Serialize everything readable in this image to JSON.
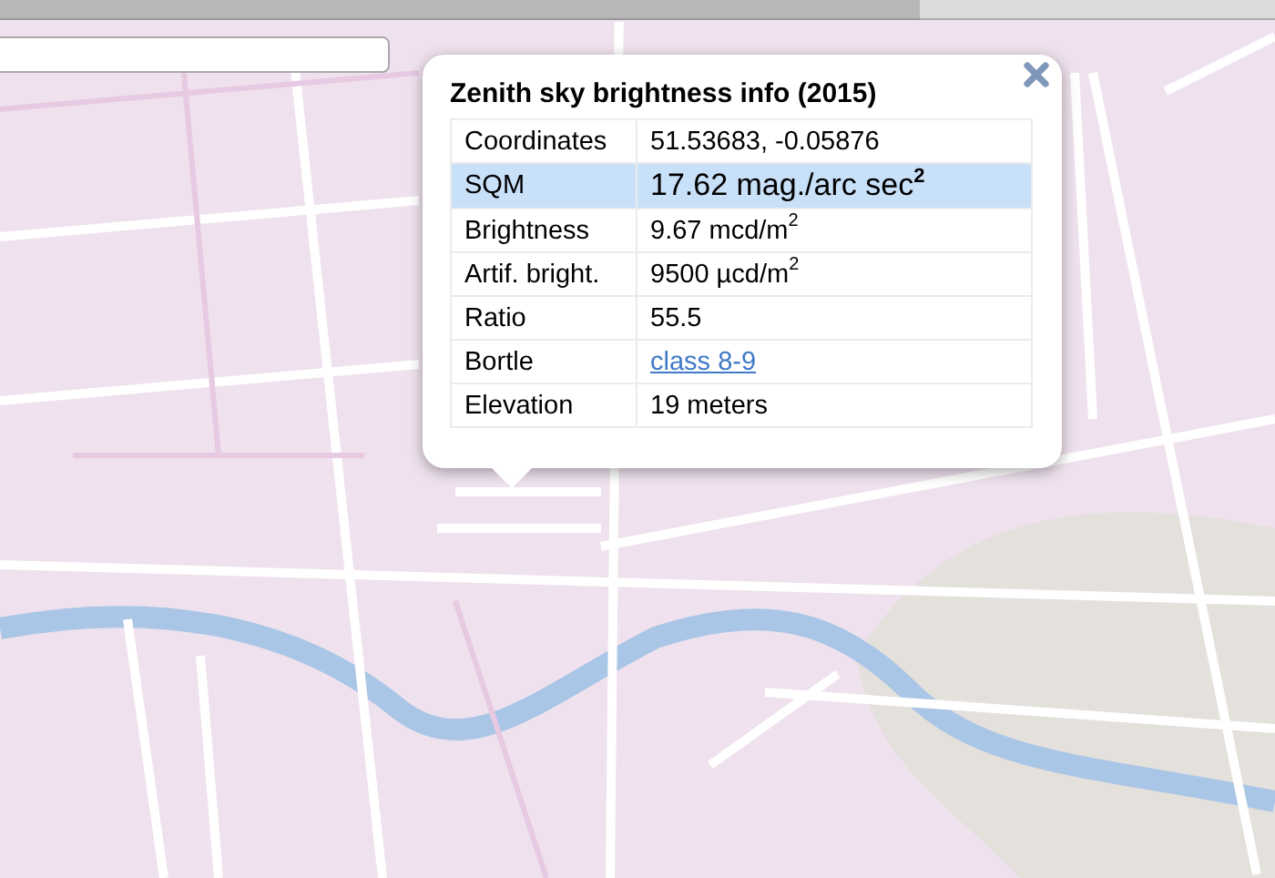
{
  "popup": {
    "title": "Zenith sky brightness info (2015)",
    "rows": [
      {
        "label": "Coordinates",
        "value": "51.53683, -0.05876",
        "kind": "text",
        "selected": false
      },
      {
        "label": "SQM",
        "value": "17.62 mag./arc sec$^{2}$",
        "kind": "text",
        "selected": true
      },
      {
        "label": "Brightness",
        "value": "9.67 mcd/m$^{2}$",
        "kind": "text",
        "selected": false
      },
      {
        "label": "Artif. bright.",
        "value": "9500 µcd/m$^{2}$",
        "kind": "text",
        "selected": false
      },
      {
        "label": "Ratio",
        "value": "55.5",
        "kind": "text",
        "selected": false
      },
      {
        "label": "Bortle",
        "value": "class 8-9",
        "kind": "link",
        "selected": false
      },
      {
        "label": "Elevation",
        "value": "19 meters",
        "kind": "text",
        "selected": false
      }
    ]
  }
}
